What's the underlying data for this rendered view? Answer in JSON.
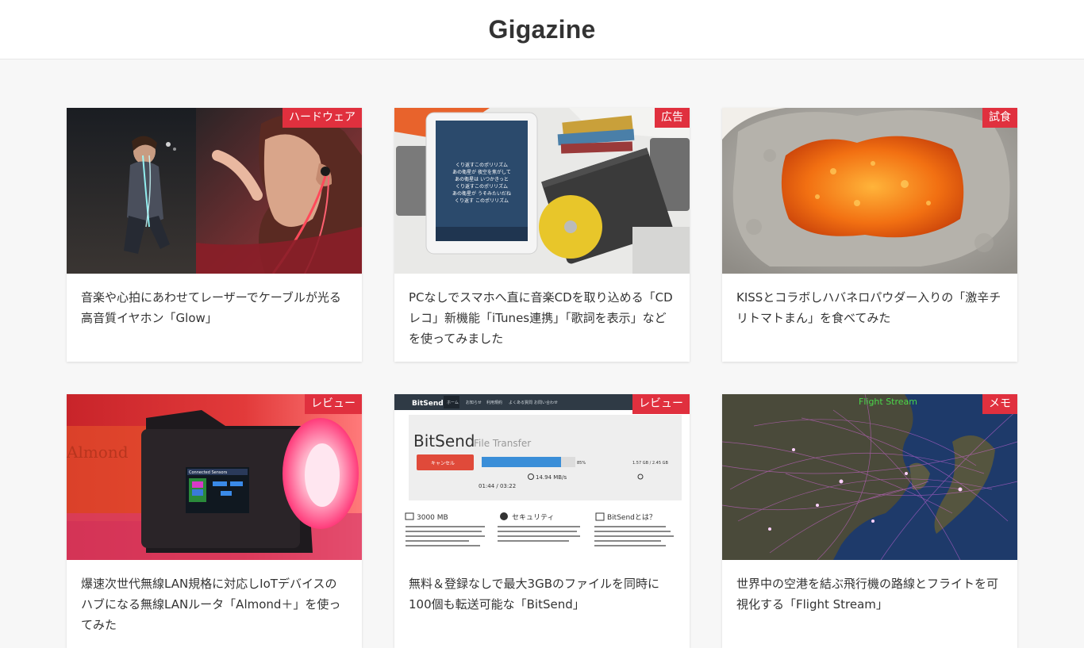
{
  "site": {
    "title": "Gigazine"
  },
  "articles": [
    {
      "category": "ハードウェア",
      "title": "音楽や心拍にあわせてレーザーでケーブルが光る高音質イヤホン「Glow」"
    },
    {
      "category": "広告",
      "title": "PCなしでスマホへ直に音楽CDを取り込める「CDレコ」新機能「iTunes連携」「歌詞を表示」などを使ってみました"
    },
    {
      "category": "試食",
      "title": "KISSとコラボしハバネロパウダー入りの「激辛チリトマトまん」を食べてみた"
    },
    {
      "category": "レビュー",
      "title": "爆速次世代無線LAN規格に対応しIoTデバイスのハブになる無線LANルータ「Almond＋」を使ってみた"
    },
    {
      "category": "レビュー",
      "title": "無料＆登録なしで最大3GBのファイルを同時に100個も転送可能な「BitSend」"
    },
    {
      "category": "メモ",
      "title": "世界中の空港を結ぶ飛行機の路線とフライトを可視化する「Flight Stream」"
    }
  ],
  "thumbnails": {
    "cdreco_screen_lines": [
      "くり返すこのポリリズム",
      "あの衛星が 夜空を焦がして",
      "あの衛星は いつかきっと",
      "くり返すこのポリリズム",
      "あの衛星が うそみたいだね",
      "くり返す このポリリズム"
    ],
    "bitsend_nav": [
      "ホーム",
      "お知らせ",
      "利用規約",
      "よくある質問",
      "お問い合わせ"
    ],
    "bitsend_brand": "BitSend",
    "bitsend_title": "BitSend",
    "bitsend_subtitle": "File Transfer",
    "bitsend_cancel": "キャンセル",
    "bitsend_percent": "85%",
    "bitsend_size": "1.57 GB / 2.45 GB",
    "bitsend_speed": "14.94 MB/s",
    "bitsend_time": "01:44 / 03:22",
    "bitsend_features": [
      "3000 MB",
      "セキュリティ",
      "BitSendとは？"
    ],
    "almond_box_text": "Almond",
    "almond_screen": "Connected Sensors",
    "flight_label": "Flight Stream"
  },
  "colors": {
    "badge": "#e0303e",
    "background": "#f7f7f7",
    "header": "#ffffff"
  }
}
